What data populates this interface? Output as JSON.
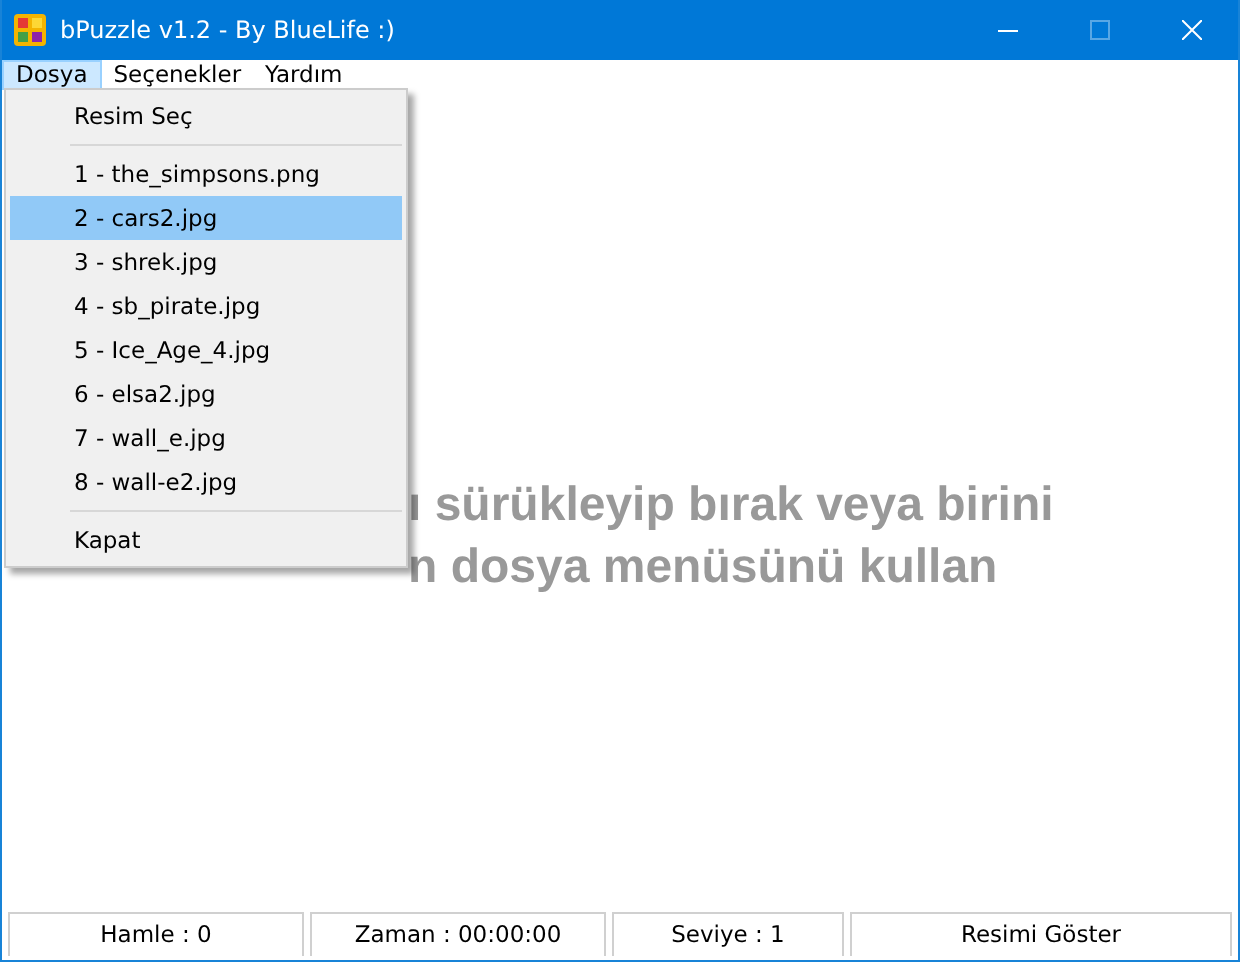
{
  "window": {
    "title": "bPuzzle v1.2 - By BlueLife :)",
    "maximize": {
      "disabled": true
    }
  },
  "menu_bar": [
    {
      "label": "Dosya",
      "selected": true
    },
    {
      "label": "Seçenekler",
      "selected": false
    },
    {
      "label": "Yardım",
      "selected": false
    }
  ],
  "dropdown": [
    {
      "kind": "item",
      "label": "Resim Seç",
      "selected": false
    },
    {
      "kind": "separator"
    },
    {
      "kind": "item",
      "label": "1 - the_simpsons.png",
      "selected": false
    },
    {
      "kind": "item",
      "label": "2 - cars2.jpg",
      "selected": true
    },
    {
      "kind": "item",
      "label": "3 - shrek.jpg",
      "selected": false
    },
    {
      "kind": "item",
      "label": "4 - sb_pirate.jpg",
      "selected": false
    },
    {
      "kind": "item",
      "label": "5 - Ice_Age_4.jpg",
      "selected": false
    },
    {
      "kind": "item",
      "label": "6 - elsa2.jpg",
      "selected": false
    },
    {
      "kind": "item",
      "label": "7 - wall_e.jpg",
      "selected": false
    },
    {
      "kind": "item",
      "label": "8 - wall-e2.jpg",
      "selected": false
    },
    {
      "kind": "separator"
    },
    {
      "kind": "item",
      "label": "Kapat",
      "selected": false
    }
  ],
  "message": [
    "ı sürükleyip bırak veya birini",
    "n dosya menüsünü kullan"
  ],
  "status_bar": [
    "Hamle : 0",
    "Zaman : 00:00:00",
    "Seviye : 1",
    "Resimi Göster"
  ]
}
